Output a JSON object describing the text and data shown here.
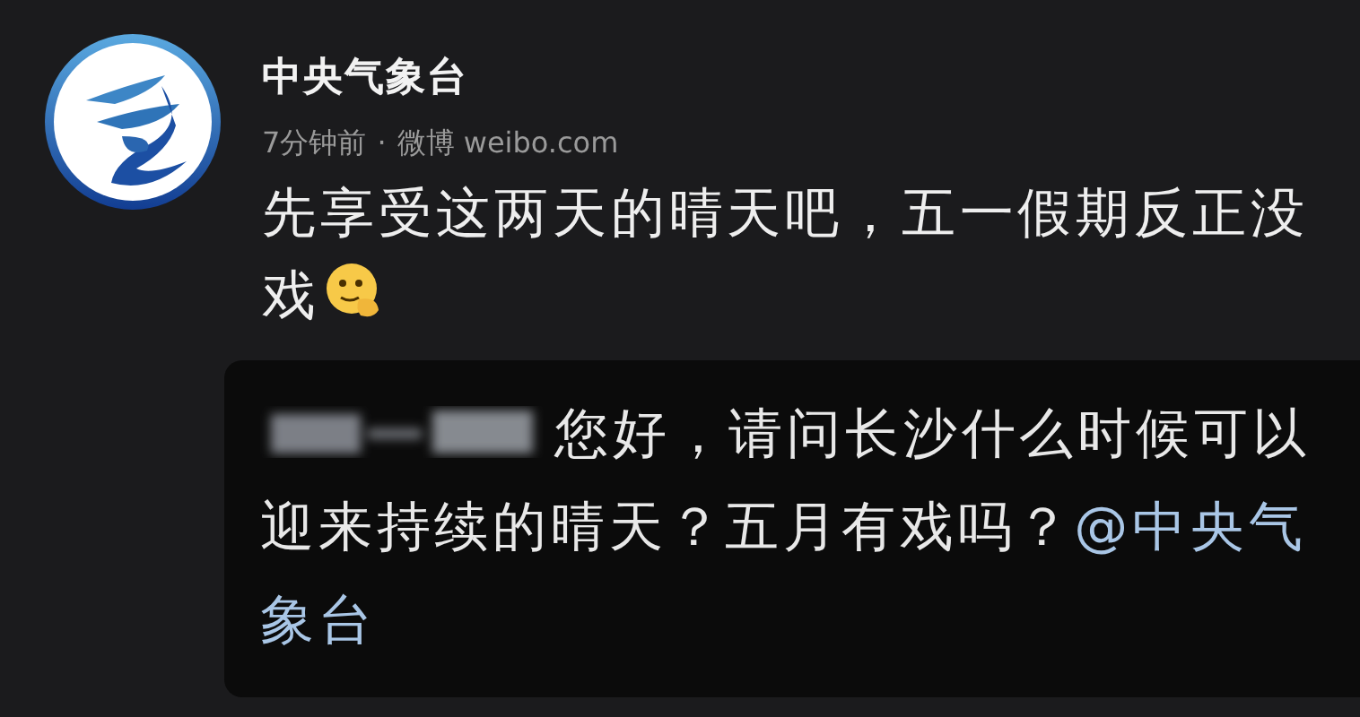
{
  "post": {
    "author": "中央气象台",
    "time": "7分钟前",
    "separator": "·",
    "source": "微博 weibo.com",
    "text": "先享受这两天的晴天吧，五一假期反正没戏"
  },
  "quote": {
    "text": "您好，请问长沙什么时候可以迎来持续的晴天？五月有戏吗？",
    "mention_parts": [
      "@中央气",
      "象台"
    ]
  }
}
